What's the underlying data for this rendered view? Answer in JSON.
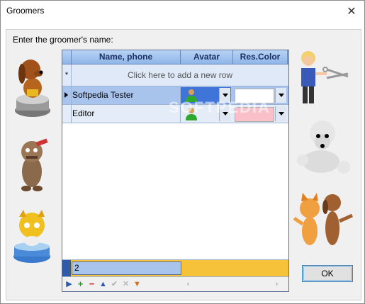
{
  "window": {
    "title": "Groomers",
    "close_glyph": "✕"
  },
  "prompt": "Enter the groomer's name:",
  "grid": {
    "columns": [
      "Name, phone",
      "Avatar",
      "Res.Color"
    ],
    "new_row_marker": "*",
    "new_row_text": "Click here to add a new row",
    "rows": [
      {
        "name": "Softpedia Tester",
        "avatar": "person-green-icon",
        "res_color": "#ffffff",
        "selected": true
      },
      {
        "name": "Editor",
        "avatar": "person-green-icon",
        "res_color": "#f9c0c9",
        "selected": false
      }
    ],
    "footer_count": "2",
    "navigator": {
      "first": "▶",
      "add": "+",
      "delete": "−",
      "up": "▲",
      "post": "✔",
      "cancel": "✕",
      "filter": "▼",
      "scroll_left": "‹",
      "scroll_right": "›"
    },
    "watermark": "SOFTPEDIA"
  },
  "ok_button": "OK",
  "colors": {
    "header": "#9fbfea",
    "selection": "#a9c4ec",
    "footer": "#f6c23a",
    "avatar_selected": "#3f74d8"
  }
}
